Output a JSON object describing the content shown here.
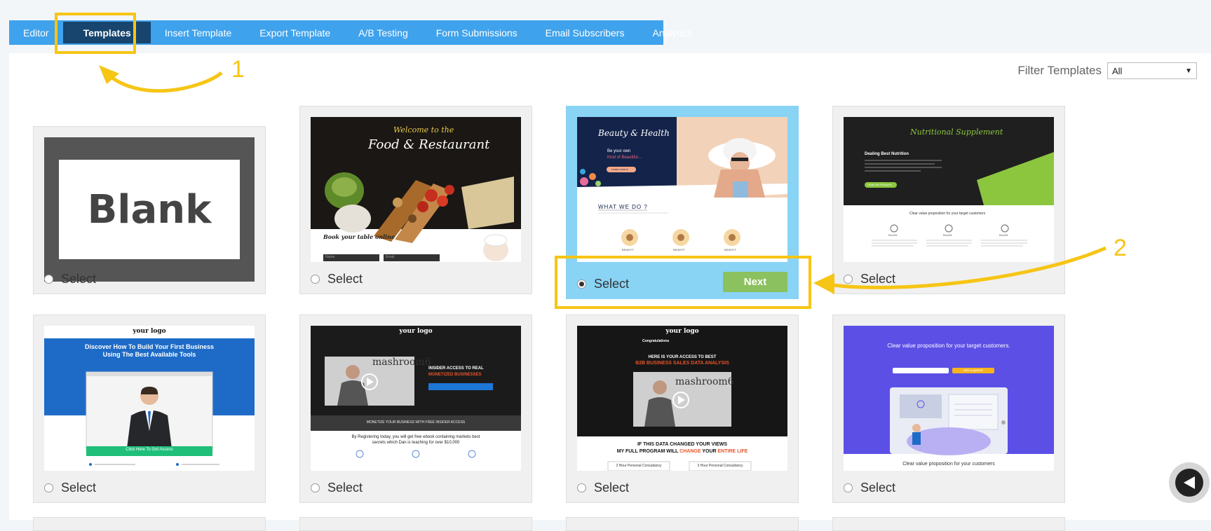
{
  "tabs": [
    {
      "label": "Editor"
    },
    {
      "label": "Templates"
    },
    {
      "label": "Insert Template"
    },
    {
      "label": "Export Template"
    },
    {
      "label": "A/B Testing"
    },
    {
      "label": "Form Submissions"
    },
    {
      "label": "Email Subscribers"
    },
    {
      "label": "Analytics"
    }
  ],
  "active_tab": "Templates",
  "filter": {
    "label": "Filter Templates",
    "value": "All"
  },
  "select_label": "Select",
  "next_label": "Next",
  "annotations": [
    "1",
    "2"
  ],
  "thumbs": {
    "blank": "Blank",
    "food": {
      "line1": "Welcome to the",
      "line2": "Food & Restaurant",
      "book": "Book your table online",
      "name": "Name",
      "email": "Email"
    },
    "beauty": {
      "title": "Beauty & Health",
      "sub1": "Be your own",
      "sub2": "Kind of Beautiful...",
      "btn": "Learn more ▸",
      "what": "WHAT WE DO ?",
      "benefit": "BENEFIT"
    },
    "nutri": {
      "title": "Nutritional Supplement",
      "dealing": "Dealing Best Nutrition",
      "btn": "Order the Product ▸",
      "value": "Clear value proposition for your target customers",
      "benefit": "Benefit"
    },
    "business": {
      "logo": "your logo",
      "title1": "Discover How To Build Your First Business",
      "title2": "Using The Best Available Tools",
      "cta": "Click Here To Get Access"
    },
    "mashroom1": {
      "logo": "your logo",
      "brand": "mashroom6",
      "insider": "INSIDER ACCESS TO REAL",
      "monetized": "MONETIZED BUSINESSES",
      "banner": "MONETIZE YOUR BUSINESS WITH FREE INSIDER ACCESS",
      "body1": "By Registering today, you will get free ebook containing markets best",
      "body2": "secrets which Dan is teaching for over $10,000"
    },
    "mashroom2": {
      "logo": "your logo",
      "congrats": "Congratulations",
      "here": "HERE IS YOUR ACCESS TO BEST",
      "b2b": "B2B BUSINESS SALES DATA ANALYSIS",
      "brand": "mashroom6",
      "if": "IF THIS DATA CHANGED YOUR VIEWS",
      "full": "MY FULL PROGRAM WILL",
      "change": "CHANGE",
      "your": "YOUR",
      "life": "ENTIRE LIFE",
      "c1": "2 Hour Personal Consultancy",
      "c2": "3 Hour Personal Consultancy"
    },
    "purple": {
      "title": "Clear value proposition for your target customers.",
      "btn": "GET A QUOTE",
      "bottom": "Clear value proposition for your customers"
    }
  }
}
